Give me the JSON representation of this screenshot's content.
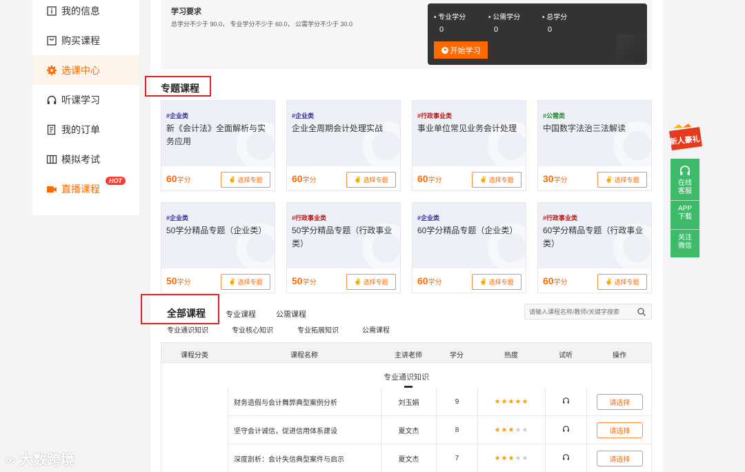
{
  "sidebar": {
    "items": [
      {
        "label": "我的信息",
        "icon": "info-icon"
      },
      {
        "label": "购买课程",
        "icon": "cart-icon"
      },
      {
        "label": "选课中心",
        "icon": "gear-icon",
        "active": true
      },
      {
        "label": "听课学习",
        "icon": "headphones-icon"
      },
      {
        "label": "我的订单",
        "icon": "order-icon"
      },
      {
        "label": "模拟考试",
        "icon": "exam-icon"
      },
      {
        "label": "直播课程",
        "icon": "video-icon",
        "badge": "HOT"
      }
    ]
  },
  "requirements": {
    "title": "学习要求",
    "text": "总学分不少于 90.0， 专业学分不少于 60.0， 公需学分不少于 30.0",
    "stats": [
      {
        "label": "• 专业学分",
        "value": "0"
      },
      {
        "label": "• 公需学分",
        "value": "0"
      },
      {
        "label": "• 总学分",
        "value": "0"
      }
    ],
    "start_button": "开始学习"
  },
  "special": {
    "title": "专题课程",
    "select_label": "选择专题",
    "credit_unit": "学分",
    "cards": [
      {
        "category": "#企业类",
        "title": "新《会计法》全面解析与实务应用",
        "credits": "60"
      },
      {
        "category": "#企业类",
        "title": "企业全周期会计处理实战",
        "credits": "60"
      },
      {
        "category": "#行政事业类",
        "title": "事业单位常见业务会计处理",
        "credits": "60"
      },
      {
        "category": "#公需类",
        "title": "中国数字法治三法解读",
        "credits": "30"
      },
      {
        "category": "#企业类",
        "title": "50学分精品专题（企业类）",
        "credits": "50"
      },
      {
        "category": "#行政事业类",
        "title": "50学分精品专题（行政事业类）",
        "credits": "50"
      },
      {
        "category": "#企业类",
        "title": "60学分精品专题（企业类）",
        "credits": "60"
      },
      {
        "category": "#行政事业类",
        "title": "60学分精品专题（行政事业类）",
        "credits": "60"
      }
    ]
  },
  "all_courses": {
    "title": "全部课程",
    "tabs": [
      "专业课程",
      "公需课程"
    ],
    "subtabs": [
      "专业通识知识",
      "专业核心知识",
      "专业拓展知识",
      "公需课程"
    ],
    "search_placeholder": "请输入课程名称/教师/关键字搜索",
    "columns": [
      "课程分类",
      "课程名称",
      "主讲老师",
      "学分",
      "热度",
      "试听",
      "操作"
    ],
    "group": "专业通识知识",
    "choose_label": "请选择",
    "rows": [
      {
        "name": "财务造假与会计舞弊典型案例分析",
        "teacher": "刘玉娟",
        "credits": "9",
        "stars": 5
      },
      {
        "name": "坚守会计诚信，促进信用体系建设",
        "teacher": "夏文杰",
        "credits": "8",
        "stars": 3
      },
      {
        "name": "深度剖析：会计失信典型案件与启示",
        "teacher": "夏文杰",
        "credits": "7",
        "stars": 3
      }
    ]
  },
  "float_bar": {
    "gift_label": "新人豪礼",
    "items": [
      "在线客服",
      "APP下载",
      "关注微信"
    ]
  },
  "watermark": "大数跨境",
  "colors": {
    "accent": "#ff6a00",
    "enterprise": "#3b2b8c",
    "public": "#2a8a3a",
    "admin": "#b01e1e",
    "float": "#3dbb6a"
  }
}
